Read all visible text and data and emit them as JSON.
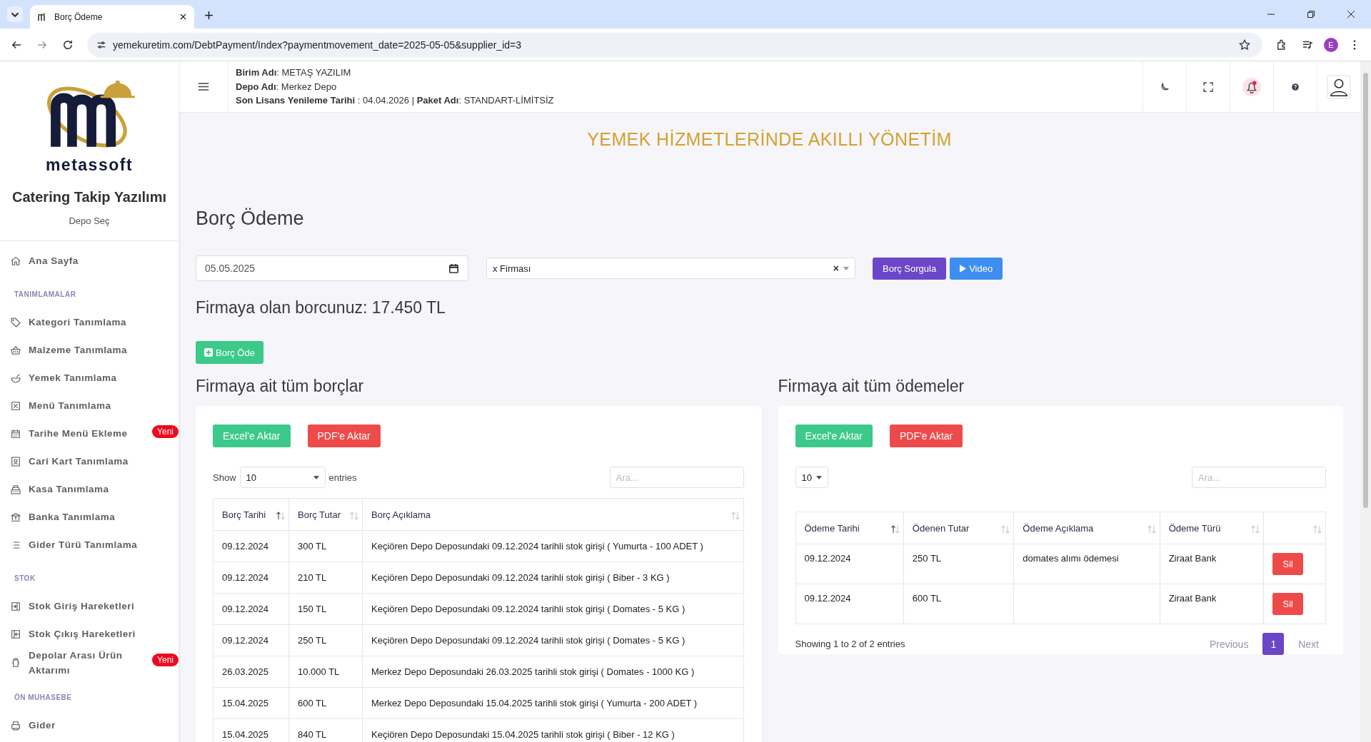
{
  "browser": {
    "tab_title": "Borç Ödeme",
    "url": "yemekuretim.com/DebtPayment/Index?paymentmovement_date=2025-05-05&supplier_id=3",
    "profile_initial": "E"
  },
  "sidebar": {
    "brand": "metassoft",
    "app_title": "Catering Takip Yazılımı",
    "depot_select": "Depo Seç",
    "sections": [
      {
        "items": [
          {
            "label": "Ana Sayfa"
          }
        ]
      },
      {
        "heading": "TANIMLAMALAR",
        "items": [
          {
            "label": "Kategori Tanımlama"
          },
          {
            "label": "Malzeme Tanımlama"
          },
          {
            "label": "Yemek Tanımlama"
          },
          {
            "label": "Menü Tanımlama"
          },
          {
            "label": "Tarihe Menü Ekleme",
            "badge": "Yeni"
          },
          {
            "label": "Cari Kart Tanımlama"
          },
          {
            "label": "Kasa Tanımlama"
          },
          {
            "label": "Banka Tanımlama"
          },
          {
            "label": "Gider Türü Tanımlama"
          }
        ]
      },
      {
        "heading": "STOK",
        "items": [
          {
            "label": "Stok Giriş Hareketleri"
          },
          {
            "label": "Stok Çıkış Hareketleri"
          },
          {
            "label": "Depolar Arası Ürün Aktarımı",
            "badge": "Yeni"
          }
        ]
      },
      {
        "heading": "ÖN MUHASEBE",
        "items": [
          {
            "label": "Gider"
          }
        ]
      }
    ]
  },
  "header": {
    "info": [
      "**Birim Adı**: METAŞ YAZILIM",
      "**Depo Adı**: Merkez Depo",
      "**Son Lisans Yenileme Tarihi** : 04.04.2026 | **Paket Adı**: STANDART-LİMİTSİZ"
    ],
    "notification_unread": true
  },
  "page": {
    "banner": "YEMEK HİZMETLERİNDE AKILLI YÖNETİM",
    "title": "Borç Ödeme",
    "date_field": {
      "value": "05.05.2025"
    },
    "supplier_select": {
      "value": "x Firması",
      "clear": "×"
    },
    "buttons": [
      {
        "label": "Borç Sorgula",
        "kind": "query"
      },
      {
        "label": "Video",
        "kind": "video"
      }
    ],
    "debt_summary": "Firmaya olan borcunuz: 17.450 TL",
    "pay_button": "Borç Öde"
  },
  "debts": {
    "title": "Firmaya ait tüm borçlar",
    "export_buttons": [
      {
        "label": "Excel'e Aktar",
        "kind": "excel"
      },
      {
        "label": "PDF'e Aktar",
        "kind": "pdf"
      }
    ],
    "length_before": "Show",
    "page_length": "10",
    "length_after": "entries",
    "search": {
      "placeholder": "Ara..."
    },
    "columns": [
      {
        "label": "Borç Tarihi",
        "sorted": true
      },
      {
        "label": "Borç Tutar",
        "sorted": false
      },
      {
        "label": "Borç Açıklama",
        "sorted": false
      }
    ],
    "rows": [
      [
        "09.12.2024",
        "300 TL",
        "Keçiören Depo Deposundaki 09.12.2024 tarihli stok girişi ( Yumurta - 100 ADET )"
      ],
      [
        "09.12.2024",
        "210 TL",
        "Keçiören Depo Deposundaki 09.12.2024 tarihli stok girişi ( Biber - 3 KG )"
      ],
      [
        "09.12.2024",
        "150 TL",
        "Keçiören Depo Deposundaki 09.12.2024 tarihli stok girişi ( Domates - 5 KG )"
      ],
      [
        "09.12.2024",
        "250 TL",
        "Keçiören Depo Deposundaki 09.12.2024 tarihli stok girişi ( Domates - 5 KG )"
      ],
      [
        "26.03.2025",
        "10.000 TL",
        "Merkez Depo Deposundaki 26.03.2025 tarihli stok girişi ( Domates - 1000 KG )"
      ],
      [
        "15.04.2025",
        "600 TL",
        "Merkez Depo Deposundaki 15.04.2025 tarihli stok girişi ( Yumurta - 200 ADET )"
      ],
      [
        "15.04.2025",
        "840 TL",
        "Keçiören Depo Deposundaki 15.04.2025 tarihli stok girişi ( Biber - 12 KG )"
      ]
    ]
  },
  "payments": {
    "title": "Firmaya ait tüm ödemeler",
    "export_buttons": [
      {
        "label": "Excel'e Aktar",
        "kind": "excel"
      },
      {
        "label": "PDF'e Aktar",
        "kind": "pdf"
      }
    ],
    "page_length": "10",
    "search": {
      "placeholder": "Ara..."
    },
    "columns": [
      {
        "label": "Ödeme Tarihi",
        "sorted": true
      },
      {
        "label": "Ödenen Tutar",
        "sorted": false
      },
      {
        "label": "Ödeme Açıklama",
        "sorted": false
      },
      {
        "label": "Ödeme Türü",
        "sorted": false
      },
      {
        "sorted": false
      }
    ],
    "rows": [
      {
        "cells": [
          "09.12.2024",
          "250 TL",
          "domates alımı ödemesi",
          "Ziraat Bank"
        ],
        "action": "Sil"
      },
      {
        "cells": [
          "09.12.2024",
          "600 TL",
          null,
          "Ziraat Bank"
        ],
        "action": "Sil"
      }
    ],
    "info": "Showing 1 to 2 of 2 entries",
    "pagination": {
      "previous": {
        "label": "Previous",
        "disabled": true
      },
      "pages": [
        {
          "label": "1",
          "selected": true
        }
      ],
      "next": {
        "label": "Next",
        "disabled": true
      }
    }
  }
}
